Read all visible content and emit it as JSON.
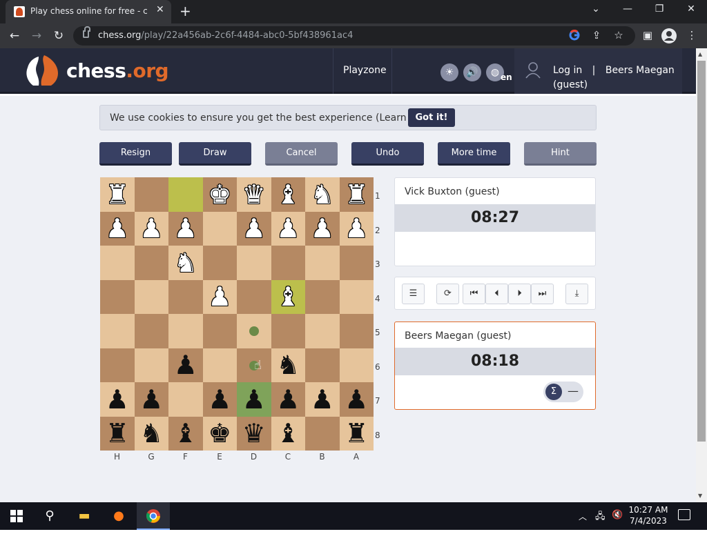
{
  "browser": {
    "tab_title": "Play chess online for free - chess.org",
    "tab_close": "✕",
    "new_tab": "+",
    "url_domain": "chess.org",
    "url_path": "/play/22a456ab-2c6f-4484-abc0-5bf438961ac4",
    "window_controls": [
      "⌄",
      "—",
      "❐",
      "✕"
    ],
    "nav": [
      "←",
      "→",
      "↻"
    ]
  },
  "site": {
    "logo_main": "chess",
    "logo_suffix": ".org",
    "nav_playzone": "Playzone",
    "lang": "en",
    "login_label": "Log in",
    "separator": "|",
    "username": "Beers Maegan",
    "guest_label": "(guest)"
  },
  "cookie": {
    "text": "We use cookies to ensure you get the best experience (Learn more)",
    "button": "Got it!"
  },
  "actions": {
    "resign": "Resign",
    "draw": "Draw",
    "cancel": "Cancel",
    "undo": "Undo",
    "more_time": "More time",
    "hint": "Hint"
  },
  "board": {
    "ranks": [
      "1",
      "2",
      "3",
      "4",
      "5",
      "6",
      "7",
      "8"
    ],
    "files": [
      "H",
      "G",
      "F",
      "E",
      "D",
      "C",
      "B",
      "A"
    ],
    "rows": [
      [
        "wR",
        "",
        "",
        "wK",
        "wQ",
        "wB",
        "wN",
        "wR"
      ],
      [
        "wP",
        "wP",
        "wP",
        "",
        "wP",
        "wP",
        "wP",
        "wP"
      ],
      [
        "",
        "",
        "wN",
        "",
        "",
        "",
        "",
        ""
      ],
      [
        "",
        "",
        "",
        "wP",
        "",
        "wB",
        "",
        ""
      ],
      [
        "",
        "",
        "",
        "",
        "",
        "",
        "",
        ""
      ],
      [
        "",
        "",
        "bP",
        "",
        "",
        "bN",
        "",
        ""
      ],
      [
        "bP",
        "bP",
        "",
        "bP",
        "bP",
        "bP",
        "bP",
        "bP"
      ],
      [
        "bR",
        "bN",
        "bB",
        "bK",
        "bQ",
        "bB",
        "",
        "bR"
      ]
    ],
    "highlight_squares": [
      "F1",
      "C4"
    ],
    "selected_square": "D7",
    "move_dots": [
      "D5",
      "D6"
    ]
  },
  "players": {
    "top_name": "Vick Buxton (guest)",
    "top_clock": "08:27",
    "bottom_name": "Beers Maegan (guest)",
    "bottom_clock": "08:18"
  },
  "controls": {
    "icons": [
      "notation-icon",
      "flip-icon",
      "first-move-icon",
      "prev-move-icon",
      "next-move-icon",
      "last-move-icon",
      "download-icon"
    ],
    "sigma": "Σ",
    "minus": "—"
  },
  "taskbar": {
    "time": "10:27 AM",
    "date": "7/4/2023"
  },
  "colors": {
    "header_bg": "#262a3b",
    "accent": "#e06a2a",
    "button_dark": "#384063",
    "board_light": "#e6c49b",
    "board_dark": "#b58963",
    "highlight": "#bcbf4c"
  }
}
